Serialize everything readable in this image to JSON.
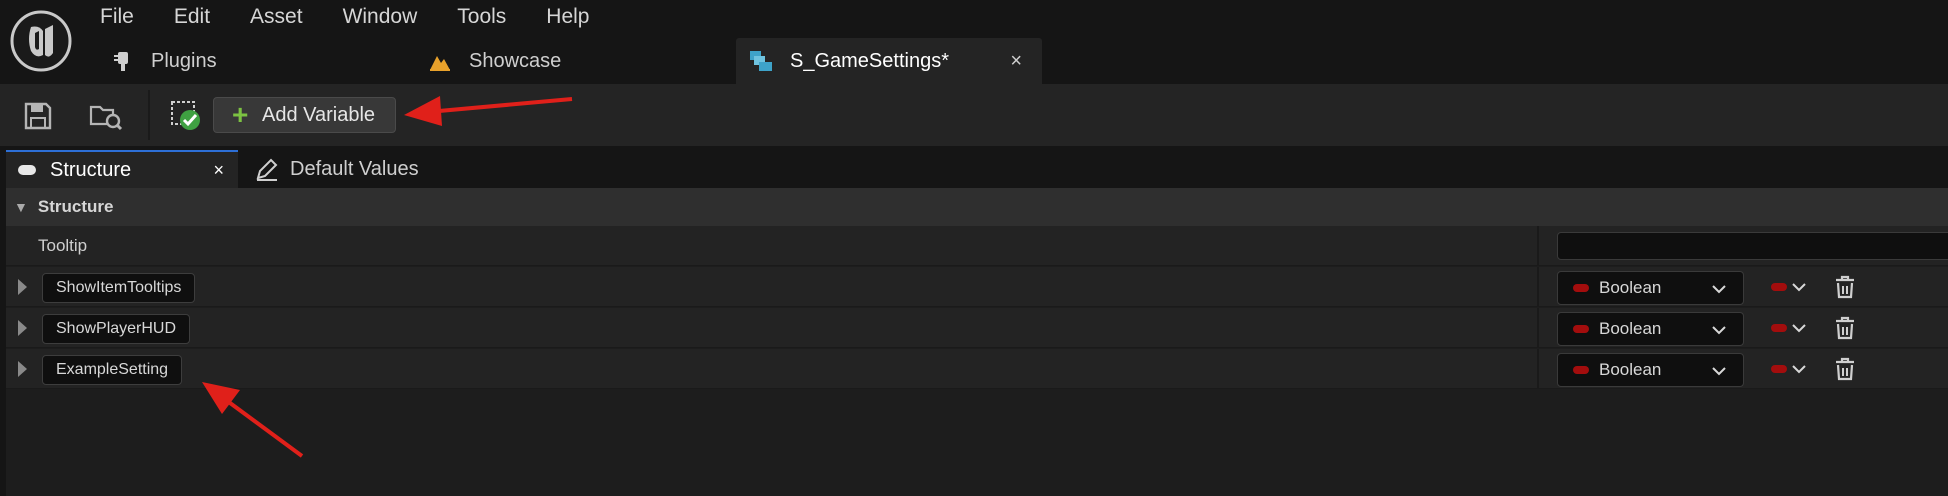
{
  "menu": {
    "items": [
      "File",
      "Edit",
      "Asset",
      "Window",
      "Tools",
      "Help"
    ]
  },
  "tabs": [
    {
      "label": "Plugins",
      "icon": "plug-icon"
    },
    {
      "label": "Showcase",
      "icon": "level-icon"
    },
    {
      "label": "S_GameSettings*",
      "icon": "struct-icon",
      "close": "×"
    }
  ],
  "toolbar": {
    "add_variable_label": "Add Variable",
    "plus_symbol": "+"
  },
  "panel_tabs": {
    "structure_label": "Structure",
    "structure_close": "×",
    "default_values_label": "Default Values"
  },
  "details": {
    "category_label": "Structure",
    "tooltip_label": "Tooltip",
    "tooltip_value": "",
    "variables": [
      {
        "name": "ShowItemTooltips",
        "type": "Boolean"
      },
      {
        "name": "ShowPlayerHUD",
        "type": "Boolean"
      },
      {
        "name": "ExampleSetting",
        "type": "Boolean"
      }
    ]
  },
  "colors": {
    "boolean_pin": "#a30d0d",
    "add_plus": "#7cc242",
    "annotation_arrow": "#e0201a",
    "active_tab_accent": "#2d6fd6"
  }
}
